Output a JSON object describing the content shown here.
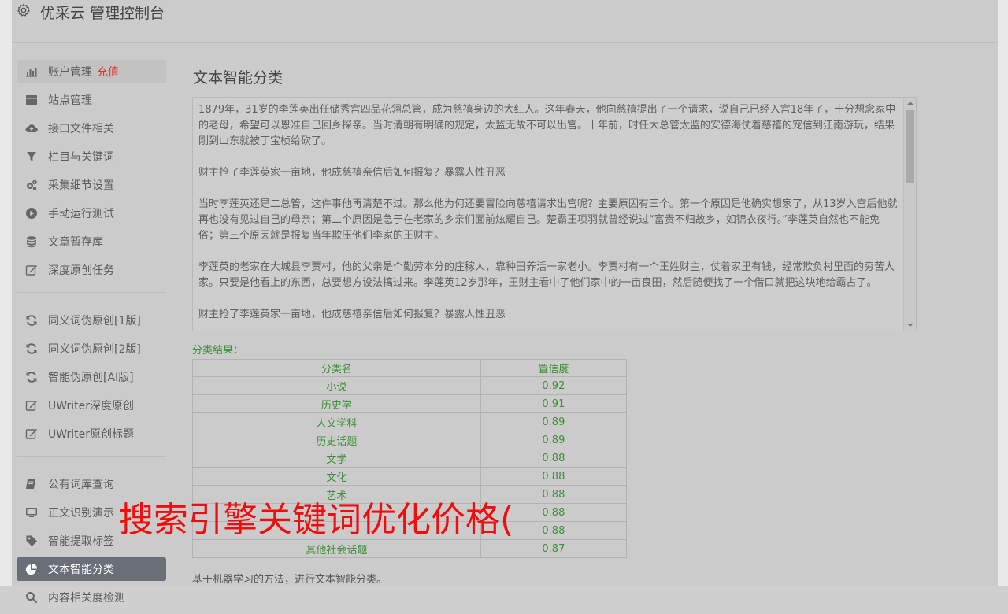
{
  "header": {
    "title": "优采云 管理控制台",
    "icon": "gear-icon"
  },
  "sidebar": {
    "group1": [
      {
        "label": "账户管理",
        "extra": "充值",
        "icon": "bar-chart-icon"
      },
      {
        "label": "站点管理",
        "icon": "server-icon"
      },
      {
        "label": "接口文件相关",
        "icon": "cloud-upload-icon"
      },
      {
        "label": "栏目与关键词",
        "icon": "filter-icon"
      },
      {
        "label": "采集细节设置",
        "icon": "gears-icon"
      },
      {
        "label": "手动运行测试",
        "icon": "play-circle-icon"
      },
      {
        "label": "文章暂存库",
        "icon": "database-icon"
      },
      {
        "label": "深度原创任务",
        "icon": "edit-icon"
      }
    ],
    "group2": [
      {
        "label": "同义词伪原创[1版]",
        "icon": "refresh-icon"
      },
      {
        "label": "同义词伪原创[2版]",
        "icon": "refresh-icon"
      },
      {
        "label": "智能伪原创[AI版]",
        "icon": "refresh-icon"
      },
      {
        "label": "UWriter深度原创",
        "icon": "edit-icon"
      },
      {
        "label": "UWriter原创标题",
        "icon": "edit-icon"
      }
    ],
    "group3": [
      {
        "label": "公有词库查询",
        "icon": "book-icon"
      },
      {
        "label": "正文识别演示",
        "icon": "monitor-icon"
      },
      {
        "label": "智能提取标签",
        "icon": "tag-icon"
      },
      {
        "label": "文本智能分类",
        "icon": "pie-chart-icon"
      },
      {
        "label": "内容相关度检测",
        "icon": "search-icon"
      }
    ]
  },
  "main": {
    "title": "文本智能分类",
    "text_paragraphs": [
      "1879年，31岁的李莲英出任储秀宫四品花翎总管，成为慈禧身边的大红人。这年春天，他向慈禧提出了一个请求，说自己已经入宫18年了，十分想念家中的老母，希望可以恩准自己回乡探亲。当时清朝有明确的规定，太监无故不可以出宫。十年前，时任大总管太监的安德海仗着慈禧的宠信到江南游玩，结果刚到山东就被丁宝桢给砍了。",
      "财主抢了李莲英家一亩地，他成慈禧亲信后如何报复？暴露人性丑恶",
      "当时李莲英还是二总管，这件事他再清楚不过。那么他为何还要冒险向慈禧请求出宫呢？主要原因有三个。第一个原因是他确实想家了，从13岁入宫后他就再也没有见过自己的母亲；第二个原因是急于在老家的乡亲们面前炫耀自己。楚霸王项羽就曾经说过“富贵不归故乡，如锦衣夜行。”李莲英自然也不能免俗；第三个原因就是报复当年欺压他们李家的王财主。",
      "李莲英的老家在大城县李贾村，他的父亲是个勤劳本分的庄稼人，靠种田养活一家老小。李贾村有一个王姓财主，仗着家里有钱，经常欺负村里面的穷苦人家。只要是他看上的东西，总要想方设法搞过来。李莲英12岁那年，王财主看中了他们家中的一亩良田，然后随便找了一个借口就把这块地给霸占了。",
      "财主抢了李莲英家一亩地，他成慈禧亲信后如何报复？暴露人性丑恶"
    ],
    "result_label": "分类结果：",
    "table": {
      "headers": [
        "分类名",
        "置信度"
      ],
      "rows": [
        [
          "小说",
          "0.92"
        ],
        [
          "历史学",
          "0.91"
        ],
        [
          "人文学科",
          "0.89"
        ],
        [
          "历史话题",
          "0.89"
        ],
        [
          "文学",
          "0.88"
        ],
        [
          "文化",
          "0.88"
        ],
        [
          "艺术",
          "0.88"
        ],
        [
          "",
          "0.88"
        ],
        [
          "",
          "0.88"
        ],
        [
          "其他社会话题",
          "0.87"
        ]
      ]
    },
    "footnote": "基于机器学习的方法，进行文本智能分类。"
  },
  "overlay": {
    "text": "搜索引擎关键词优化价格("
  },
  "colors": {
    "accent_green": "#3b8f33",
    "recharge_red": "#d9302c",
    "active_bg": "#6a6f77",
    "overlay_red": "#f20d0d"
  }
}
